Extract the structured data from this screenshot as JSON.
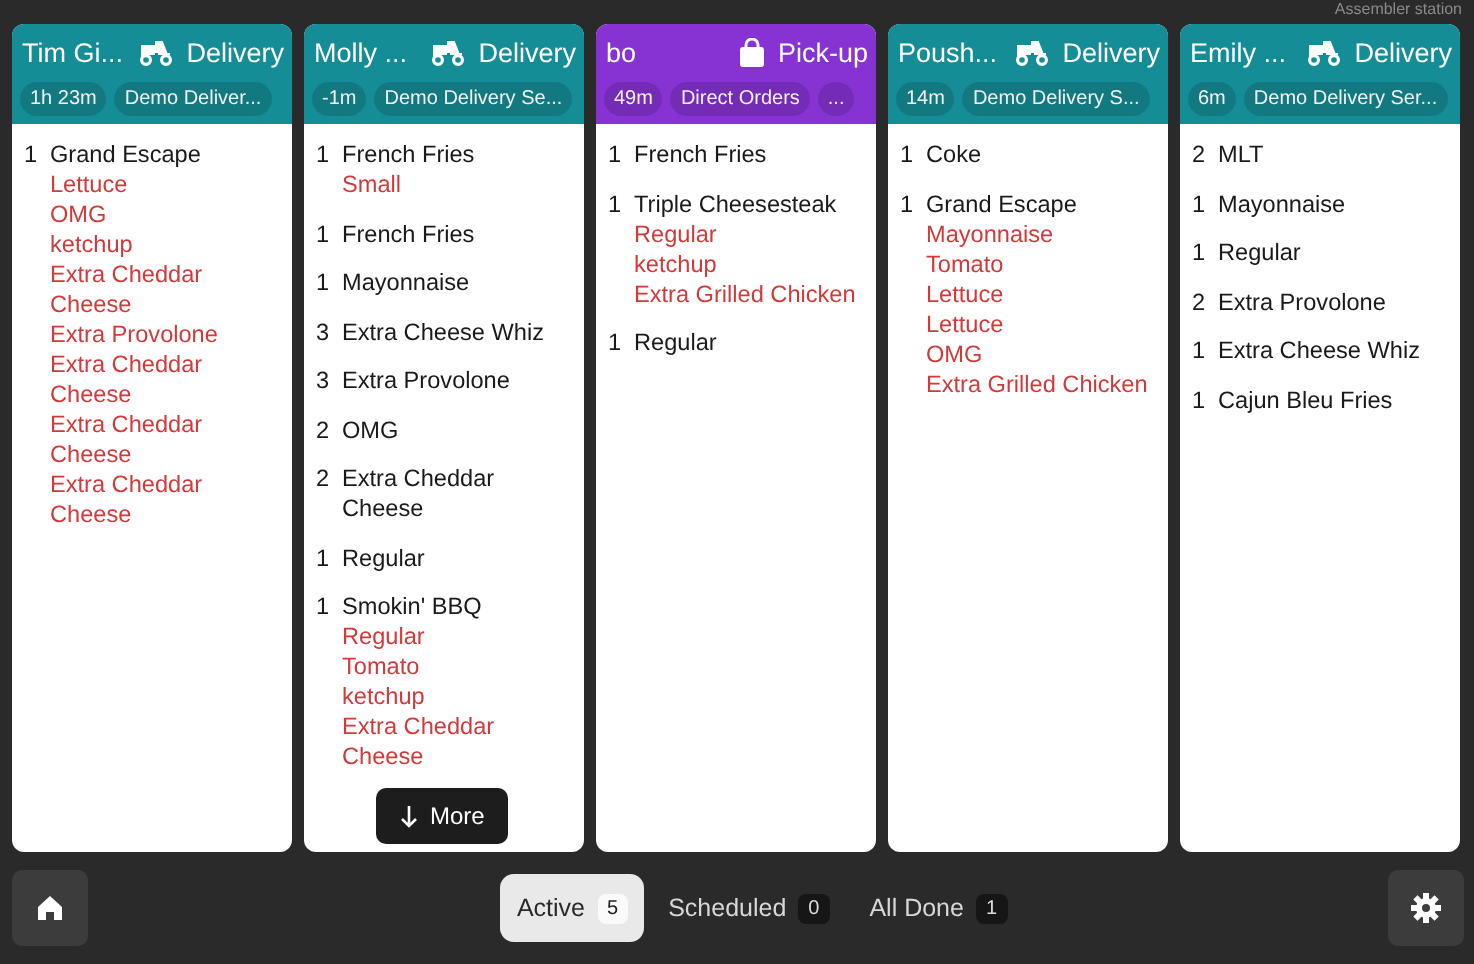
{
  "station": "Assembler station",
  "orders": [
    {
      "name": "Tim Gi...",
      "kind": "delivery",
      "type_label": "Delivery",
      "chips": [
        "1h 23m",
        "Demo Deliver..."
      ],
      "items": [
        {
          "qty": "1",
          "name": "Grand Escape",
          "modifiers": [
            "Lettuce",
            "OMG",
            "ketchup",
            "Extra Cheddar Cheese",
            "Extra Provolone",
            "Extra Cheddar Cheese",
            "Extra Cheddar Cheese",
            "Extra Cheddar Cheese"
          ]
        }
      ]
    },
    {
      "name": "Molly ...",
      "kind": "delivery",
      "type_label": "Delivery",
      "chips": [
        "-1m",
        "Demo Delivery Se..."
      ],
      "items": [
        {
          "qty": "1",
          "name": "French Fries",
          "modifiers": [
            "Small"
          ]
        },
        {
          "qty": "1",
          "name": "French Fries"
        },
        {
          "qty": "1",
          "name": "Mayonnaise"
        },
        {
          "qty": "3",
          "name": "Extra Cheese Whiz"
        },
        {
          "qty": "3",
          "name": "Extra Provolone"
        },
        {
          "qty": "2",
          "name": "OMG"
        },
        {
          "qty": "2",
          "name": "Extra Cheddar Cheese"
        },
        {
          "qty": "1",
          "name": "Regular"
        },
        {
          "qty": "1",
          "name": "Smokin' BBQ",
          "modifiers": [
            "Regular",
            "Tomato",
            "ketchup",
            "Extra Cheddar Cheese"
          ]
        }
      ],
      "more": "More"
    },
    {
      "name": "bo",
      "kind": "pickup",
      "type_label": "Pick-up",
      "chips": [
        "49m",
        "Direct Orders",
        "..."
      ],
      "items": [
        {
          "qty": "1",
          "name": "French Fries"
        },
        {
          "qty": "1",
          "name": "Triple Cheesesteak",
          "modifiers": [
            "Regular",
            "ketchup",
            "Extra Grilled Chicken"
          ]
        },
        {
          "qty": "1",
          "name": "Regular"
        }
      ]
    },
    {
      "name": "Poush...",
      "kind": "delivery",
      "type_label": "Delivery",
      "chips": [
        "14m",
        "Demo Delivery S..."
      ],
      "items": [
        {
          "qty": "1",
          "name": "Coke"
        },
        {
          "qty": "1",
          "name": "Grand Escape",
          "modifiers": [
            "Mayonnaise",
            "Tomato",
            "Lettuce",
            "Lettuce",
            "OMG",
            "Extra Grilled Chicken"
          ]
        }
      ]
    },
    {
      "name": "Emily ...",
      "kind": "delivery",
      "type_label": "Delivery",
      "chips": [
        "6m",
        "Demo Delivery Ser..."
      ],
      "items": [
        {
          "qty": "2",
          "name": "MLT"
        },
        {
          "qty": "1",
          "name": "Mayonnaise"
        },
        {
          "qty": "1",
          "name": "Regular"
        },
        {
          "qty": "2",
          "name": "Extra Provolone"
        },
        {
          "qty": "1",
          "name": "Extra Cheese Whiz"
        },
        {
          "qty": "1",
          "name": "Cajun Bleu Fries"
        }
      ]
    }
  ],
  "tabs": [
    {
      "label": "Active",
      "count": "5",
      "selected": true
    },
    {
      "label": "Scheduled",
      "count": "0",
      "selected": false
    },
    {
      "label": "All Done",
      "count": "1",
      "selected": false
    }
  ]
}
